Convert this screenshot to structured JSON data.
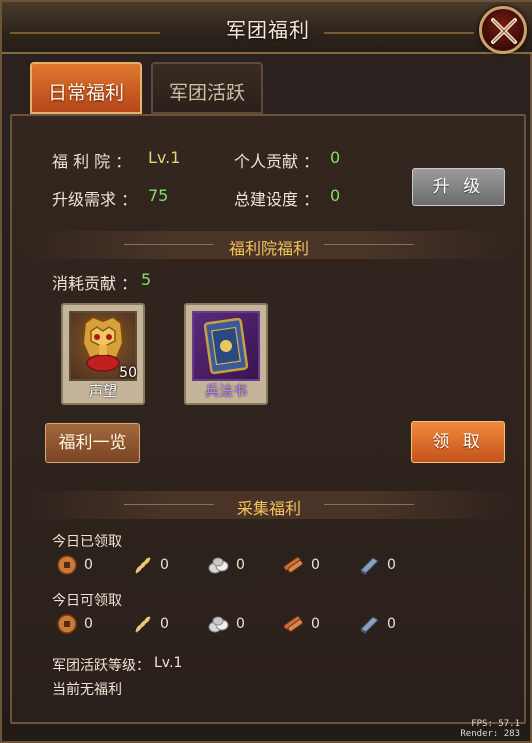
{
  "window": {
    "title": "军团福利"
  },
  "tabs": [
    {
      "label": "日常福利",
      "active": true
    },
    {
      "label": "军团活跃",
      "active": false
    }
  ],
  "stats": {
    "hall_label": "福 利 院 ：",
    "hall_value": "Lv.1",
    "contribution_label": "个人贡献 ：",
    "contribution_value": "0",
    "upgrade_req_label": "升级需求 ：",
    "upgrade_req_value": "75",
    "construction_label": "总建设度 ：",
    "construction_value": "0",
    "upgrade_button": "升 级"
  },
  "hall_welfare": {
    "title": "福利院福利",
    "cost_label": "消耗贡献 ：",
    "cost_value": "5",
    "items": [
      {
        "name": "声望",
        "count": "50",
        "icon": "prestige-helmet-icon"
      },
      {
        "name": "兵法书",
        "count": "",
        "icon": "strategy-book-icon"
      }
    ],
    "list_button": "福利一览",
    "claim_button": "领 取"
  },
  "gather_welfare": {
    "title": "采集福利",
    "claimed_label": "今日已领取",
    "claimable_label": "今日可领取",
    "resources": [
      {
        "icon": "coin-icon",
        "claimed": "0",
        "claimable": "0"
      },
      {
        "icon": "wheat-icon",
        "claimed": "0",
        "claimable": "0"
      },
      {
        "icon": "stone-icon",
        "claimed": "0",
        "claimable": "0"
      },
      {
        "icon": "wood-icon",
        "claimed": "0",
        "claimable": "0"
      },
      {
        "icon": "iron-icon",
        "claimed": "0",
        "claimable": "0"
      }
    ],
    "activity_level_label": "军团活跃等级：",
    "activity_level_value": "Lv.1",
    "status_text": "当前无福利"
  },
  "debug": {
    "fps": "FPS: 57.1",
    "render": "Render:  283"
  },
  "colors": {
    "accent_orange": "#e0782e",
    "value_green": "#7fe06a",
    "value_yellow": "#e6d37a",
    "section_gold": "#f2c45a"
  }
}
